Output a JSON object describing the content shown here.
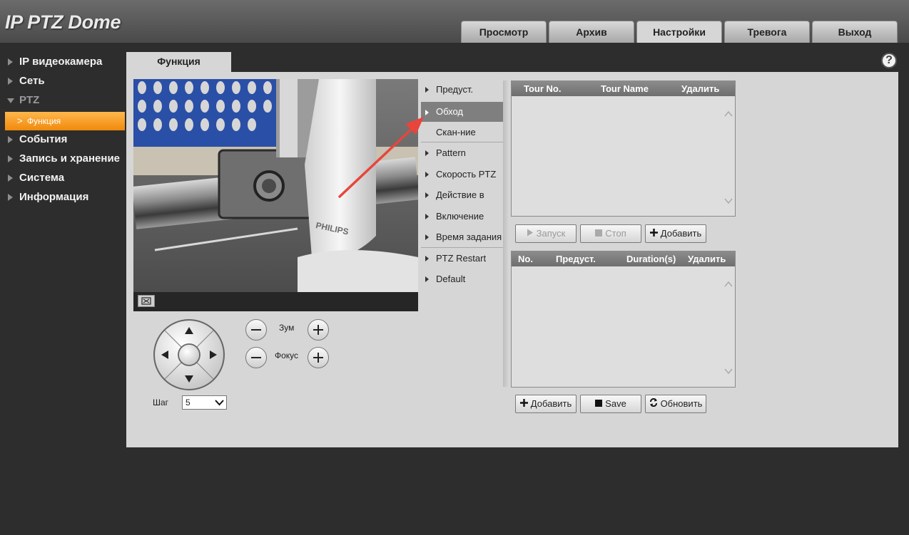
{
  "header": {
    "logo": "IP PTZ Dome",
    "tabs": [
      {
        "label": "Просмотр"
      },
      {
        "label": "Архив"
      },
      {
        "label": "Настройки"
      },
      {
        "label": "Тревога"
      },
      {
        "label": "Выход"
      }
    ],
    "active_tab": "Настройки"
  },
  "sidebar": {
    "items": [
      {
        "label": "IP видеокамера"
      },
      {
        "label": "Сеть"
      },
      {
        "label": "PTZ"
      },
      {
        "label": "События"
      },
      {
        "label": "Запись и хранение"
      },
      {
        "label": "Система"
      },
      {
        "label": "Информация"
      }
    ],
    "sub_item": "Функция",
    "sub_chevron": ">"
  },
  "content": {
    "tab": "Функция",
    "help": "?",
    "video": {
      "brand_text": "PHILIPS"
    }
  },
  "ptz": {
    "zoom_label": "Зум",
    "focus_label": "Фокус",
    "step_label": "Шаг",
    "step_value": "5"
  },
  "func_menu": {
    "items": [
      {
        "label": "Предуст."
      },
      {
        "label": "Обход"
      },
      {
        "label": "Скан-ние"
      },
      {
        "label": "Pattern"
      },
      {
        "label": "Скорость PTZ"
      },
      {
        "label": "Действие в"
      },
      {
        "label": "Включение"
      },
      {
        "label": "Время задания"
      },
      {
        "label": "PTZ Restart"
      },
      {
        "label": "Default"
      }
    ],
    "active": "Обход"
  },
  "tour_table": {
    "headers": [
      "Tour No.",
      "Tour Name",
      "Удалить"
    ],
    "rows": []
  },
  "tour_buttons": {
    "start": "Запуск",
    "stop": "Стоп",
    "add": "Добавить"
  },
  "preset_table": {
    "headers": [
      "No.",
      "Предуст.",
      "Duration(s)",
      "Удалить"
    ],
    "rows": []
  },
  "preset_buttons": {
    "add": "Добавить",
    "save": "Save",
    "refresh": "Обновить"
  },
  "colors": {
    "accent": "#f39a1e",
    "annotation": "#e8453c"
  }
}
